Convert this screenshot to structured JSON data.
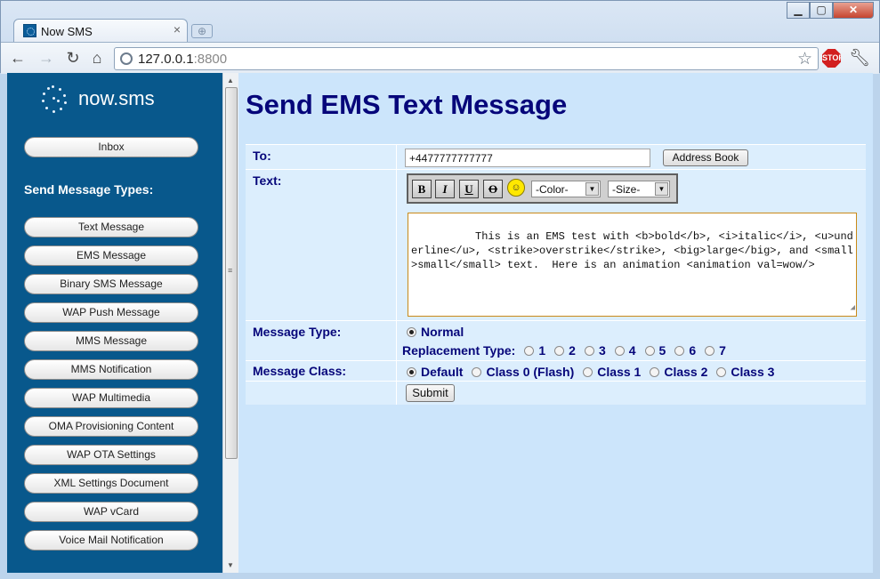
{
  "browser": {
    "tab_title": "Now SMS",
    "tab_close": "×",
    "newtab_icon": "⊕",
    "url_host": "127.0.0.1",
    "url_port": ":8800",
    "window_buttons": {
      "minimize": "▁",
      "maximize": "▢",
      "close": "✕"
    },
    "extension_label": "STOP"
  },
  "sidebar": {
    "logo_text": "now.sms",
    "inbox_label": "Inbox",
    "heading": "Send Message Types:",
    "items": [
      {
        "label": "Text Message"
      },
      {
        "label": "EMS Message"
      },
      {
        "label": "Binary SMS Message"
      },
      {
        "label": "WAP Push Message"
      },
      {
        "label": "MMS Message"
      },
      {
        "label": "MMS Notification"
      },
      {
        "label": "WAP Multimedia"
      },
      {
        "label": "OMA Provisioning Content"
      },
      {
        "label": "WAP OTA Settings"
      },
      {
        "label": "XML Settings Document"
      },
      {
        "label": "WAP vCard"
      },
      {
        "label": "Voice Mail Notification"
      }
    ]
  },
  "main": {
    "title": "Send EMS Text Message",
    "to": {
      "label": "To:",
      "value": "+4477777777777",
      "address_book_label": "Address Book"
    },
    "text": {
      "label": "Text:",
      "toolbar": {
        "bold": "B",
        "italic": "I",
        "underline": "U",
        "strike": "O",
        "color_value": "-Color-",
        "size_value": "-Size-"
      },
      "value": "This is an EMS test with <b>bold</b>, <i>italic</i>, <u>underline</u>, <strike>overstrike</strike>, <big>large</big>, and <small>small</small> text.  Here is an animation <animation val=wow/>"
    },
    "message_type": {
      "label": "Message Type:",
      "normal_label": "Normal",
      "replacement_label": "Replacement Type:",
      "replacement_options": [
        "1",
        "2",
        "3",
        "4",
        "5",
        "6",
        "7"
      ]
    },
    "message_class": {
      "label": "Message Class:",
      "options": [
        "Default",
        "Class 0 (Flash)",
        "Class 1",
        "Class 2",
        "Class 3"
      ],
      "selected": "Default"
    },
    "submit_label": "Submit"
  }
}
